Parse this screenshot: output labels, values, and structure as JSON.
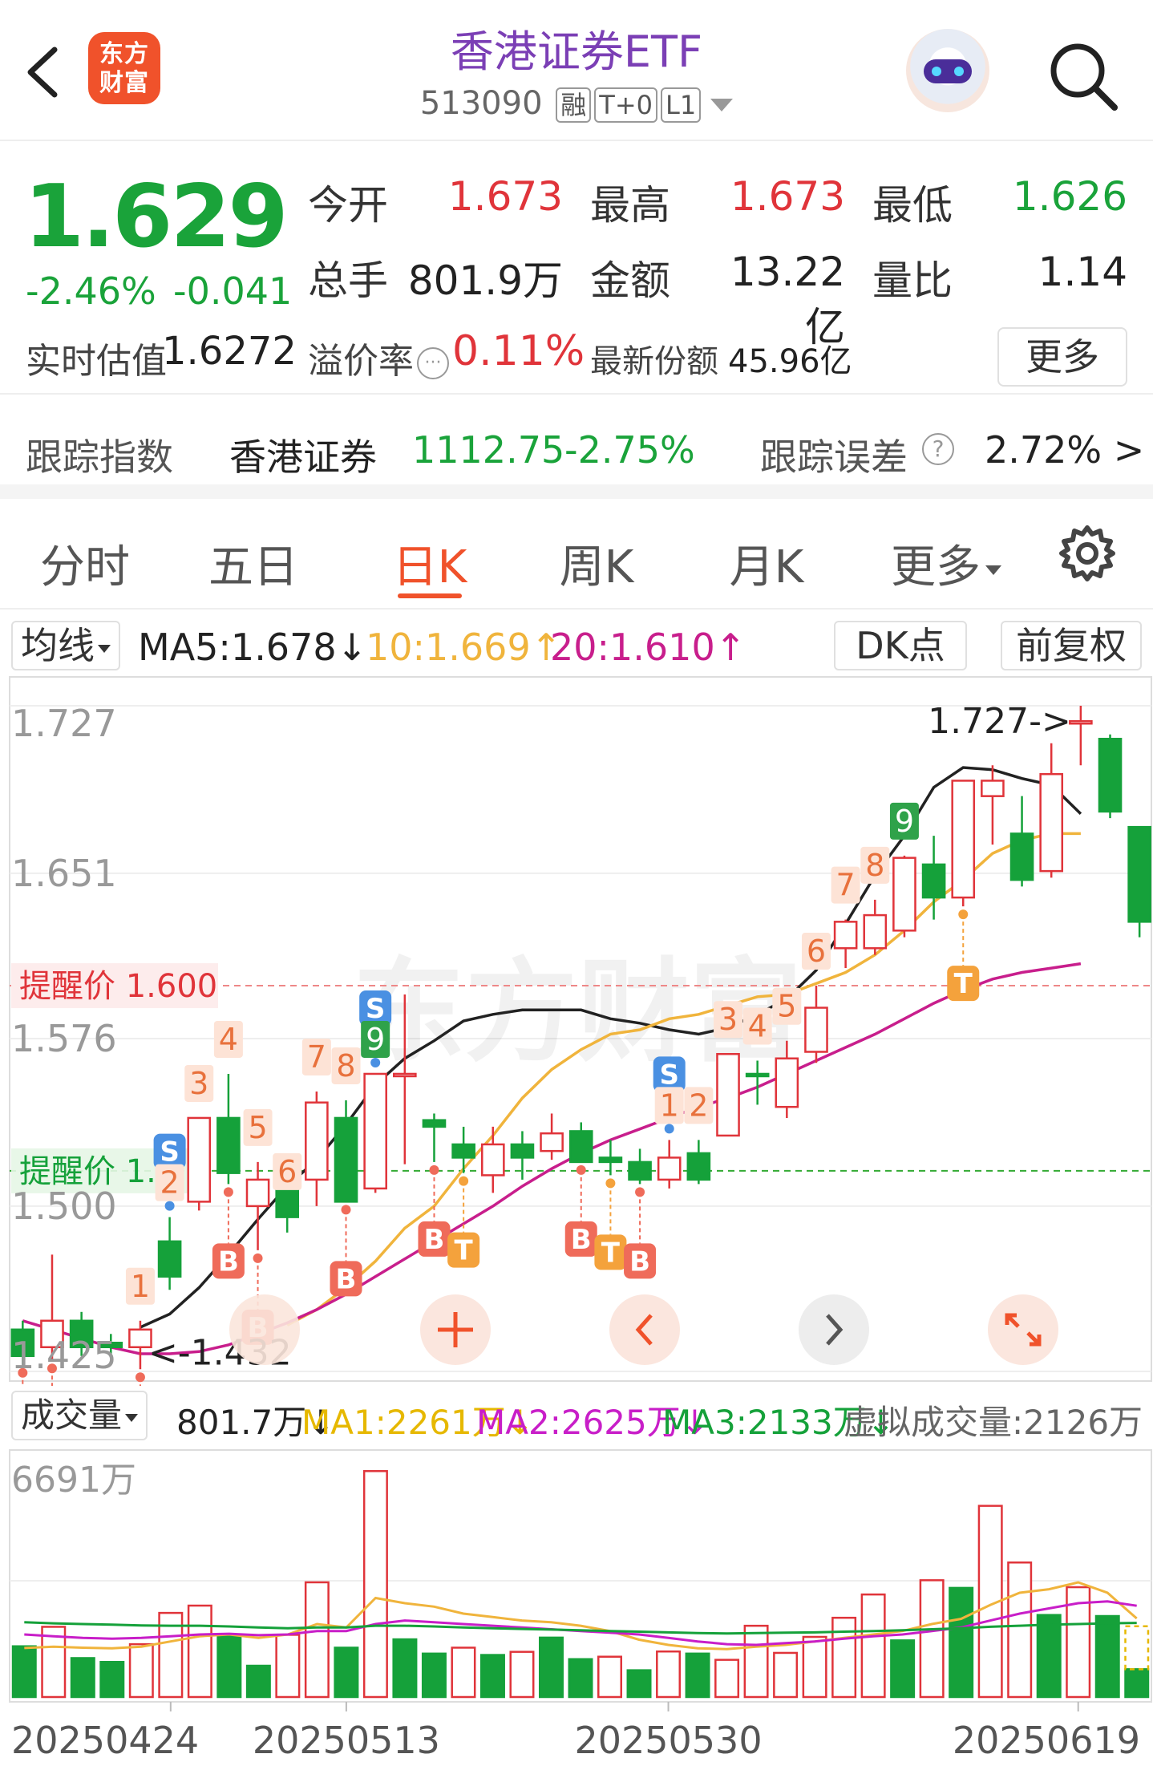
{
  "header": {
    "title": "香港证券ETF",
    "code": "513090",
    "tags": [
      "融",
      "T+0",
      "L1"
    ],
    "logo_text": "东方财富"
  },
  "quote": {
    "price": "1.629",
    "change_pct": "-2.46%",
    "change": "-0.041",
    "open_label": "今开",
    "open": "1.673",
    "high_label": "最高",
    "high": "1.673",
    "low_label": "最低",
    "low": "1.626",
    "vol_label": "总手",
    "volume": "801.9万",
    "amt_label": "金额",
    "amount": "13.22亿",
    "ratio_label": "量比",
    "ratio": "1.14",
    "iopv_label": "实时估值",
    "iopv": "1.6272",
    "premium_label": "溢价率",
    "premium": "0.11%",
    "shares_label": "最新份额",
    "shares": "45.96亿",
    "more_label": "更多"
  },
  "tracking": {
    "label": "跟踪指数",
    "index_name": "香港证券",
    "index_value": "1112.75",
    "index_change": "-2.75%",
    "error_label": "跟踪误差",
    "error_value": "2.72% >"
  },
  "tabs": [
    "分时",
    "五日",
    "日K",
    "周K",
    "月K",
    "更多"
  ],
  "active_tab": 2,
  "ma_bar": {
    "avg_label": "均线",
    "ma5": "MA5:1.678↓",
    "ma10": "10:1.669↑",
    "ma20": "20:1.610↑",
    "dk_label": "DK点",
    "adj_label": "前复权"
  },
  "vol_bar": {
    "label": "成交量",
    "current": "801.7万↓",
    "ma1": "MA1:2261万↓",
    "ma2": "MA2:2625万↓",
    "ma3": "MA3:2133万↓",
    "virtual": "虚拟成交量:2126万"
  },
  "colors": {
    "up": "#e0343a",
    "down": "#15a13a",
    "ma5": "#222222",
    "ma10": "#f0b43c",
    "ma20": "#c81e8c",
    "accent": "#f0522b",
    "title": "#7b3fb5"
  },
  "icons": [
    "back-arrow-icon",
    "search-icon",
    "question-circle-icon",
    "gear-icon",
    "plus-icon",
    "chevron-left-icon",
    "chevron-right-icon",
    "expand-icon"
  ],
  "chart_data": [
    {
      "type": "candlestick",
      "ylim": [
        1.425,
        1.727
      ],
      "y_ticks": [
        "1.727",
        "1.651",
        "1.576",
        "1.500",
        "1.425"
      ],
      "annotations": {
        "high_marker": "1.727->",
        "low_marker": "<-1.432",
        "alert_high": "提醒价 1.600",
        "alert_low": "提醒价 1.5"
      },
      "series": [
        {
          "name": "MA5",
          "values": [
            null,
            null,
            null,
            null,
            1.445,
            1.451,
            1.463,
            1.478,
            1.494,
            1.509,
            1.521,
            1.537,
            1.555,
            1.567,
            1.575,
            1.584,
            1.587,
            1.589,
            1.589,
            1.589,
            1.585,
            1.583,
            1.58,
            1.578,
            1.581,
            1.587,
            1.594,
            1.607,
            1.628,
            1.65,
            1.668,
            1.69,
            1.699,
            1.698,
            1.694,
            1.691,
            1.678
          ]
        },
        {
          "name": "MA10",
          "values": [
            null,
            null,
            null,
            null,
            null,
            null,
            null,
            null,
            null,
            1.446,
            1.453,
            1.463,
            1.475,
            1.49,
            1.5,
            1.517,
            1.532,
            1.549,
            1.562,
            1.571,
            1.578,
            1.58,
            1.585,
            1.587,
            1.591,
            1.595,
            1.596,
            1.601,
            1.606,
            1.614,
            1.625,
            1.638,
            1.648,
            1.66,
            1.666,
            1.669,
            1.669
          ]
        },
        {
          "name": "MA20",
          "values": [
            1.448,
            1.444,
            1.44,
            1.436,
            1.433,
            1.433,
            1.434,
            1.437,
            1.442,
            1.447,
            1.453,
            1.46,
            1.468,
            1.476,
            1.484,
            1.492,
            1.5,
            1.509,
            1.517,
            1.524,
            1.53,
            1.535,
            1.54,
            1.545,
            1.549,
            1.554,
            1.56,
            1.566,
            1.572,
            1.578,
            1.585,
            1.592,
            1.598,
            1.603,
            1.606,
            1.608,
            1.61
          ]
        }
      ],
      "candles": [
        {
          "o": 1.444,
          "h": 1.448,
          "l": 1.428,
          "c": 1.432
        },
        {
          "o": 1.436,
          "h": 1.478,
          "l": 1.43,
          "c": 1.448
        },
        {
          "o": 1.448,
          "h": 1.452,
          "l": 1.432,
          "c": 1.436
        },
        {
          "o": 1.438,
          "h": 1.442,
          "l": 1.432,
          "c": 1.436
        },
        {
          "o": 1.436,
          "h": 1.448,
          "l": 1.426,
          "c": 1.444
        },
        {
          "o": 1.484,
          "h": 1.495,
          "l": 1.462,
          "c": 1.468
        },
        {
          "o": 1.502,
          "h": 1.54,
          "l": 1.498,
          "c": 1.54
        },
        {
          "o": 1.54,
          "h": 1.56,
          "l": 1.51,
          "c": 1.515
        },
        {
          "o": 1.5,
          "h": 1.52,
          "l": 1.48,
          "c": 1.512
        },
        {
          "o": 1.51,
          "h": 1.5,
          "l": 1.488,
          "c": 1.495
        },
        {
          "o": 1.512,
          "h": 1.552,
          "l": 1.5,
          "c": 1.547
        },
        {
          "o": 1.54,
          "h": 1.548,
          "l": 1.502,
          "c": 1.502
        },
        {
          "o": 1.508,
          "h": 1.56,
          "l": 1.506,
          "c": 1.56
        },
        {
          "o": 1.56,
          "h": 1.596,
          "l": 1.519,
          "c": 1.56
        },
        {
          "o": 1.539,
          "h": 1.542,
          "l": 1.52,
          "c": 1.536
        },
        {
          "o": 1.528,
          "h": 1.536,
          "l": 1.515,
          "c": 1.522
        },
        {
          "o": 1.514,
          "h": 1.536,
          "l": 1.506,
          "c": 1.528
        },
        {
          "o": 1.528,
          "h": 1.534,
          "l": 1.512,
          "c": 1.522
        },
        {
          "o": 1.525,
          "h": 1.542,
          "l": 1.521,
          "c": 1.533
        },
        {
          "o": 1.534,
          "h": 1.538,
          "l": 1.52,
          "c": 1.52
        },
        {
          "o": 1.522,
          "h": 1.53,
          "l": 1.514,
          "c": 1.52
        },
        {
          "o": 1.52,
          "h": 1.526,
          "l": 1.51,
          "c": 1.512
        },
        {
          "o": 1.512,
          "h": 1.53,
          "l": 1.508,
          "c": 1.522
        },
        {
          "o": 1.524,
          "h": 1.53,
          "l": 1.51,
          "c": 1.512
        },
        {
          "o": 1.532,
          "h": 1.569,
          "l": 1.532,
          "c": 1.569
        },
        {
          "o": 1.56,
          "h": 1.566,
          "l": 1.546,
          "c": 1.559
        },
        {
          "o": 1.545,
          "h": 1.575,
          "l": 1.54,
          "c": 1.567
        },
        {
          "o": 1.57,
          "h": 1.6,
          "l": 1.565,
          "c": 1.59
        },
        {
          "o": 1.617,
          "h": 1.63,
          "l": 1.608,
          "c": 1.629
        },
        {
          "o": 1.617,
          "h": 1.639,
          "l": 1.614,
          "c": 1.632
        },
        {
          "o": 1.625,
          "h": 1.659,
          "l": 1.622,
          "c": 1.658
        },
        {
          "o": 1.655,
          "h": 1.668,
          "l": 1.63,
          "c": 1.64
        },
        {
          "o": 1.64,
          "h": 1.693,
          "l": 1.636,
          "c": 1.693
        },
        {
          "o": 1.686,
          "h": 1.7,
          "l": 1.664,
          "c": 1.693
        },
        {
          "o": 1.669,
          "h": 1.686,
          "l": 1.645,
          "c": 1.648
        },
        {
          "o": 1.652,
          "h": 1.71,
          "l": 1.649,
          "c": 1.696
        },
        {
          "o": 1.72,
          "h": 1.727,
          "l": 1.7,
          "c": 1.72
        },
        {
          "o": 1.712,
          "h": 1.714,
          "l": 1.676,
          "c": 1.679
        },
        {
          "o": 1.672,
          "h": 1.672,
          "l": 1.622,
          "c": 1.629
        }
      ],
      "markers": [
        {
          "i": 0,
          "label": "B"
        },
        {
          "i": 1,
          "label": "B"
        },
        {
          "i": 4,
          "label": "B"
        },
        {
          "i": 5,
          "label": "S"
        },
        {
          "i": 7,
          "label": "B"
        },
        {
          "i": 8,
          "label": "B"
        },
        {
          "i": 11,
          "label": "B"
        },
        {
          "i": 12,
          "label": "S"
        },
        {
          "i": 14,
          "label": "B"
        },
        {
          "i": 15,
          "label": "T"
        },
        {
          "i": 19,
          "label": "B"
        },
        {
          "i": 20,
          "label": "T"
        },
        {
          "i": 21,
          "label": "B"
        },
        {
          "i": 22,
          "label": "S"
        },
        {
          "i": 32,
          "label": "T"
        }
      ],
      "nine_count": [
        {
          "i": 4,
          "label": "1"
        },
        {
          "i": 5,
          "label": "2"
        },
        {
          "i": 6,
          "label": "3"
        },
        {
          "i": 7,
          "label": "4"
        },
        {
          "i": 8,
          "label": "5"
        },
        {
          "i": 9,
          "label": "6"
        },
        {
          "i": 10,
          "label": "7"
        },
        {
          "i": 11,
          "label": "8"
        },
        {
          "i": 12,
          "label": "9"
        },
        {
          "i": 22,
          "label": "1"
        },
        {
          "i": 23,
          "label": "2"
        },
        {
          "i": 24,
          "label": "3"
        },
        {
          "i": 25,
          "label": "4"
        },
        {
          "i": 26,
          "label": "5"
        },
        {
          "i": 27,
          "label": "6"
        },
        {
          "i": 28,
          "label": "7"
        },
        {
          "i": 29,
          "label": "8"
        },
        {
          "i": 30,
          "label": "9"
        }
      ]
    },
    {
      "type": "bar",
      "title": "成交量",
      "unit": "万",
      "ylim": [
        0,
        6691
      ],
      "y_ticks": [
        "6691万"
      ],
      "x_ticks": [
        "20250424",
        "20250513",
        "20250530",
        "20250619"
      ],
      "values": [
        1460,
        2020,
        1120,
        1010,
        1520,
        2420,
        2630,
        1800,
        900,
        1790,
        3300,
        1420,
        6500,
        1660,
        1250,
        1420,
        1210,
        1300,
        1710,
        1090,
        1160,
        770,
        1310,
        1250,
        1070,
        2050,
        1270,
        1730,
        2280,
        2950,
        1630,
        3360,
        3140,
        5500,
        3870,
        2360,
        3160,
        2330,
        800
      ],
      "up": [
        false,
        true,
        false,
        false,
        true,
        true,
        true,
        false,
        false,
        true,
        true,
        false,
        true,
        false,
        false,
        true,
        false,
        true,
        false,
        false,
        true,
        false,
        true,
        false,
        true,
        true,
        true,
        true,
        true,
        true,
        false,
        true,
        false,
        true,
        true,
        false,
        true,
        false,
        false
      ],
      "series": [
        {
          "name": "MA1",
          "values": [
            1410,
            1450,
            1420,
            1400,
            1450,
            1600,
            1750,
            1800,
            1700,
            1800,
            2100,
            2000,
            2850,
            2700,
            2600,
            2400,
            2300,
            2200,
            2150,
            2050,
            1900,
            1650,
            1500,
            1400,
            1380,
            1450,
            1500,
            1600,
            1700,
            1800,
            1900,
            2100,
            2250,
            2650,
            3000,
            3100,
            3300,
            3000,
            2261
          ]
        },
        {
          "name": "MA2",
          "values": [
            1800,
            1750,
            1700,
            1680,
            1700,
            1750,
            1800,
            1820,
            1780,
            1800,
            1900,
            1900,
            2100,
            2200,
            2150,
            2100,
            2050,
            2000,
            1950,
            1900,
            1850,
            1800,
            1700,
            1600,
            1520,
            1500,
            1550,
            1600,
            1680,
            1750,
            1800,
            1900,
            2000,
            2200,
            2400,
            2550,
            2700,
            2750,
            2625
          ]
        },
        {
          "name": "MA3",
          "values": [
            2150,
            2120,
            2100,
            2080,
            2060,
            2050,
            2050,
            2030,
            2000,
            1980,
            2000,
            2000,
            2050,
            2050,
            2030,
            2000,
            1980,
            1960,
            1940,
            1920,
            1900,
            1880,
            1860,
            1840,
            1830,
            1840,
            1850,
            1860,
            1880,
            1900,
            1920,
            1950,
            1980,
            2020,
            2050,
            2080,
            2100,
            2120,
            2133
          ]
        }
      ]
    }
  ]
}
